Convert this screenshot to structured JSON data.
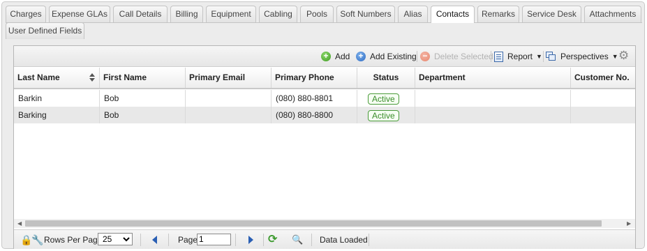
{
  "tabs_row1": [
    "Charges",
    "Expense GLAs",
    "Call Details",
    "Billing",
    "Equipment",
    "Cabling",
    "Pools",
    "Soft Numbers",
    "Alias",
    "Contacts",
    "Remarks",
    "Service Desk",
    "Attachments"
  ],
  "tabs_row2": [
    "User Defined Fields"
  ],
  "active_tab": "Contacts",
  "toolbar": {
    "add": "Add",
    "add_existing": "Add Existing",
    "delete_selected": "Delete Selected",
    "report": "Report",
    "perspectives": "Perspectives"
  },
  "columns": [
    "Last Name",
    "First Name",
    "Primary Email",
    "Primary Phone",
    "Status",
    "Department",
    "Customer No."
  ],
  "rows": [
    {
      "last_name": "Barkin",
      "first_name": "Bob",
      "primary_email": "",
      "primary_phone": "(080) 880-8801",
      "status": "Active",
      "department": "",
      "customer_no": ""
    },
    {
      "last_name": "Barking",
      "first_name": "Bob",
      "primary_email": "",
      "primary_phone": "(080) 880-8800",
      "status": "Active",
      "department": "",
      "customer_no": ""
    }
  ],
  "footer": {
    "rows_per_page_label": "Rows Per Page:",
    "rows_per_page_value": "25",
    "page_label": "Page:",
    "page_value": "1",
    "status": "Data Loaded"
  },
  "colors": {
    "status_active": "#3b8c2b",
    "nav_arrow": "#2a5fb4"
  }
}
